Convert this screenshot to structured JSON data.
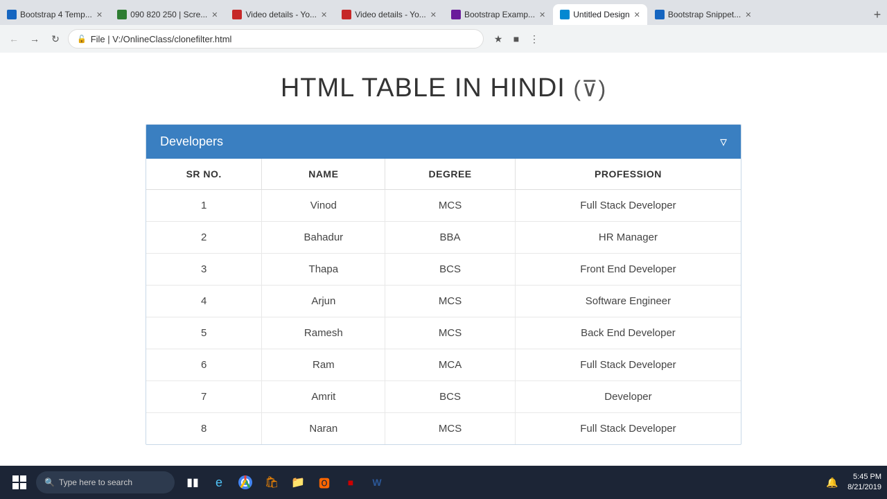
{
  "browser": {
    "tabs": [
      {
        "id": "tab1",
        "label": "Bootstrap 4 Temp...",
        "favicon_color": "#1565c0",
        "active": false
      },
      {
        "id": "tab2",
        "label": "090 820 250 | Scre...",
        "favicon_color": "#2e7d32",
        "active": false
      },
      {
        "id": "tab3",
        "label": "Video details - Yo...",
        "favicon_color": "#c62828",
        "active": false
      },
      {
        "id": "tab4",
        "label": "Video details - Yo...",
        "favicon_color": "#c62828",
        "active": false
      },
      {
        "id": "tab5",
        "label": "Bootstrap Examp...",
        "favicon_color": "#6a1b9a",
        "active": false
      },
      {
        "id": "tab6",
        "label": "Untitled Design",
        "favicon_color": "#0288d1",
        "active": true
      },
      {
        "id": "tab7",
        "label": "Bootstrap Snippet...",
        "favicon_color": "#1565c0",
        "active": false
      }
    ],
    "url": "File  |  V:/OnlineClass/clonefilter.html",
    "new_tab_label": "+"
  },
  "page": {
    "title": "HTML TABLE IN HINDI",
    "filter_icon": "⊽",
    "table": {
      "panel_title": "Developers",
      "columns": [
        "SR NO.",
        "NAME",
        "DEGREE",
        "PROFESSION"
      ],
      "rows": [
        {
          "sr": "1",
          "name": "Vinod",
          "degree": "MCS",
          "profession": "Full Stack Developer"
        },
        {
          "sr": "2",
          "name": "Bahadur",
          "degree": "BBA",
          "profession": "HR Manager"
        },
        {
          "sr": "3",
          "name": "Thapa",
          "degree": "BCS",
          "profession": "Front End Developer"
        },
        {
          "sr": "4",
          "name": "Arjun",
          "degree": "MCS",
          "profession": "Software Engineer"
        },
        {
          "sr": "5",
          "name": "Ramesh",
          "degree": "MCS",
          "profession": "Back End Developer"
        },
        {
          "sr": "6",
          "name": "Ram",
          "degree": "MCA",
          "profession": "Full Stack Developer"
        },
        {
          "sr": "7",
          "name": "Amrit",
          "degree": "BCS",
          "profession": "Developer"
        },
        {
          "sr": "8",
          "name": "Naran",
          "degree": "MCS",
          "profession": "Full Stack Developer"
        }
      ]
    }
  },
  "taskbar": {
    "search_placeholder": "Type here to search",
    "time": "5:45 PM",
    "date": "8/21/2019"
  }
}
